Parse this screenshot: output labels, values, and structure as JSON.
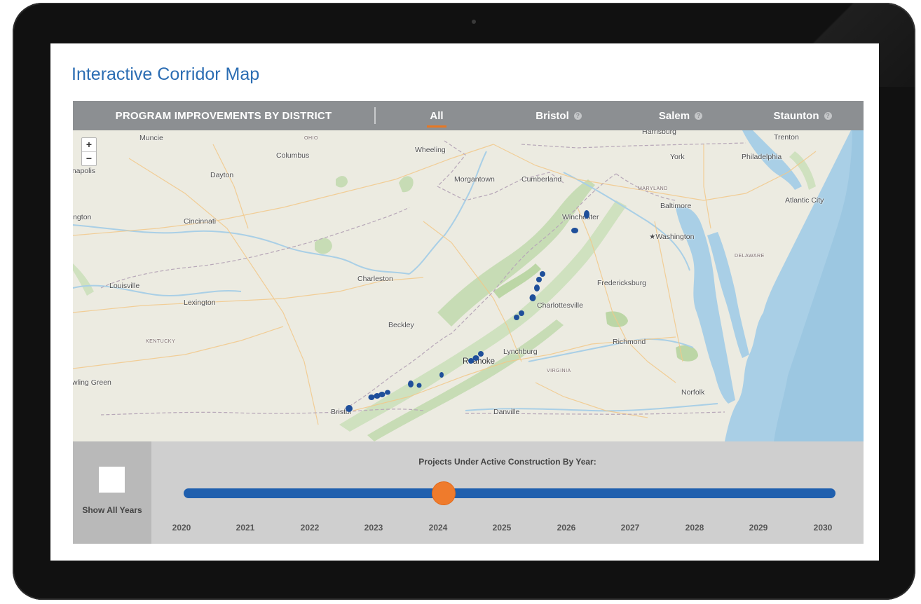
{
  "page": {
    "title": "Interactive Corridor Map"
  },
  "nav": {
    "heading": "PROGRAM IMPROVEMENTS BY DISTRICT",
    "tabs": [
      {
        "label": "All",
        "active": true
      },
      {
        "label": "Bristol",
        "help_icon": "help-icon"
      },
      {
        "label": "Salem",
        "help_icon": "help-icon"
      },
      {
        "label": "Staunton",
        "help_icon": "help-icon"
      }
    ]
  },
  "map": {
    "zoom_in_label": "+",
    "zoom_out_label": "−",
    "marker_color": "#1f4f9a",
    "labels": {
      "muncie": "Muncie",
      "ohio": "OHIO",
      "wheeling": "Wheeling",
      "harrisburg": "Harrisburg",
      "trenton": "Trenton",
      "columbus": "Columbus",
      "york": "York",
      "philadelphia": "Philadelphia",
      "indianapolis": "Indianapolis",
      "dayton": "Dayton",
      "morgantown": "Morgantown",
      "cumberland": "Cumberland",
      "maryland": "MARYLAND",
      "baltimore": "Baltimore",
      "atlantic_city": "Atlantic City",
      "bloomington": "Bloomington",
      "cincinnati": "Cincinnati",
      "winchester": "Winchester",
      "washington": "Washington",
      "delaware": "DELAWARE",
      "charleston": "Charleston",
      "fredericksburg": "Fredericksburg",
      "louisville": "Louisville",
      "lexington": "Lexington",
      "charlottesville": "Charlottesville",
      "beckley": "Beckley",
      "kentucky": "KENTUCKY",
      "richmond": "Richmond",
      "lynchburg": "Lynchburg",
      "roanoke": "Roanoke",
      "virginia": "VIRGINIA",
      "bowling_green": "Bowling Green",
      "norfolk": "Norfolk",
      "bristol": "Bristol",
      "danville": "Danville"
    }
  },
  "timeline": {
    "show_all_label": "Show All Years",
    "show_all_checked": false,
    "title": "Projects Under Active Construction By Year:",
    "years": [
      "2020",
      "2021",
      "2022",
      "2023",
      "2024",
      "2025",
      "2026",
      "2027",
      "2028",
      "2029",
      "2030"
    ],
    "selected_year": "2024",
    "track_color": "#1f5fae",
    "thumb_color": "#ef7b2c"
  }
}
